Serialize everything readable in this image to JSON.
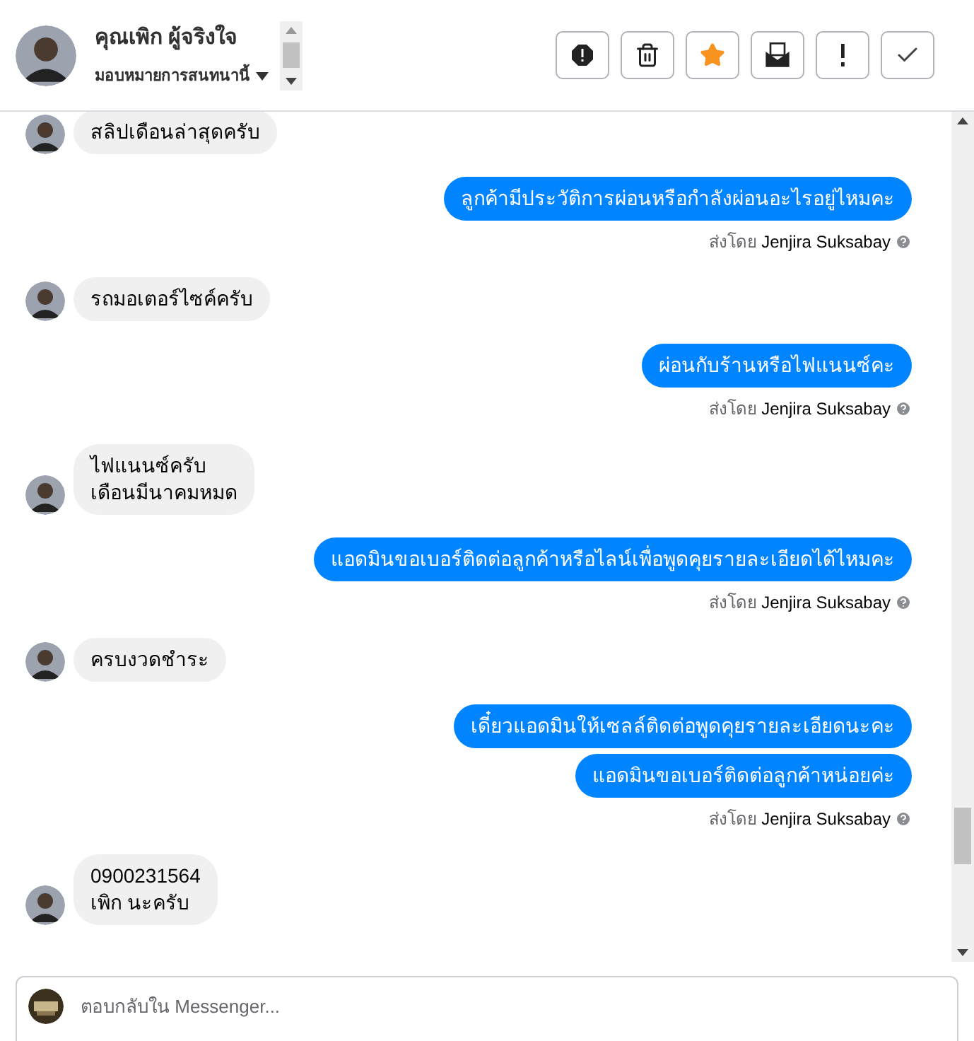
{
  "header": {
    "name": "คุณเพิก ผู้จริงใจ",
    "assign": "มอบหมายการสนทนานี้",
    "actions": [
      {
        "kind": "alert"
      },
      {
        "kind": "trash"
      },
      {
        "kind": "star"
      },
      {
        "kind": "mail"
      },
      {
        "kind": "exclaim"
      },
      {
        "kind": "check"
      }
    ]
  },
  "messages": [
    {
      "kind": "in",
      "bubbles": [
        "สลิปเดือนล่าสุดครับ"
      ]
    },
    {
      "kind": "out",
      "bubbles": [
        "ลูกค้ามีประวัติการผ่อนหรือกำลังผ่อนอะไรอยู่ไหมคะ"
      ],
      "sent_label": "ส่งโดย",
      "sender": "Jenjira Suksabay"
    },
    {
      "kind": "in",
      "bubbles": [
        "รถมอเตอร์ไซค์ครับ"
      ]
    },
    {
      "kind": "out",
      "bubbles": [
        "ผ่อนกับร้านหรือไฟแนนซ์คะ"
      ],
      "sent_label": "ส่งโดย",
      "sender": "Jenjira Suksabay"
    },
    {
      "kind": "in",
      "bubbles": [
        "ไฟแนนซ์ครับ\nเดือนมีนาคมหมด"
      ]
    },
    {
      "kind": "out",
      "bubbles": [
        "แอดมินขอเบอร์ติดต่อลูกค้าหรือไลน์เพื่อพูดคุยรายละเอียดได้ไหมคะ"
      ],
      "sent_label": "ส่งโดย",
      "sender": "Jenjira Suksabay"
    },
    {
      "kind": "in",
      "bubbles": [
        "ครบงวดชำระ"
      ]
    },
    {
      "kind": "out",
      "bubbles": [
        "เดี๋ยวแอดมินให้เซลล์ติดต่อพูดคุยรายละเอียดนะคะ",
        "แอดมินขอเบอร์ติดต่อลูกค้าหน่อยค่ะ"
      ],
      "sent_label": "ส่งโดย",
      "sender": "Jenjira Suksabay"
    },
    {
      "kind": "in",
      "bubbles": [
        "0900231564\nเพิก นะครับ"
      ]
    }
  ],
  "composer": {
    "placeholder": "ตอบกลับใน Messenger..."
  }
}
